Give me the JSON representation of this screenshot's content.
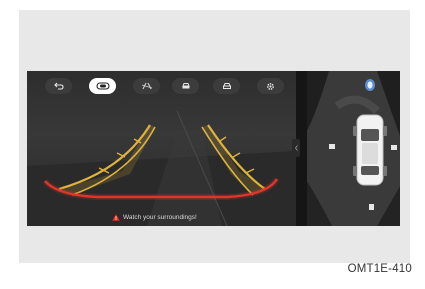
{
  "toolbar": {
    "buttons": [
      {
        "name": "back",
        "icon": "back-arrow-icon",
        "active": false
      },
      {
        "name": "rear-view",
        "icon": "rear-camera-icon",
        "active": true
      },
      {
        "name": "guidelines",
        "icon": "guideline-icon",
        "active": false
      },
      {
        "name": "car-view-1",
        "icon": "car-front-icon",
        "active": false
      },
      {
        "name": "car-view-2",
        "icon": "car-top-icon",
        "active": false
      },
      {
        "name": "settings",
        "icon": "gear-icon",
        "active": false
      }
    ]
  },
  "warning": {
    "text": "Watch your surroundings!",
    "icon": "warning-triangle-icon",
    "color": "#e0352b"
  },
  "guide_colors": {
    "near": "#e0352b",
    "far": "#e0b43a"
  },
  "caption": "OMT1E-410"
}
